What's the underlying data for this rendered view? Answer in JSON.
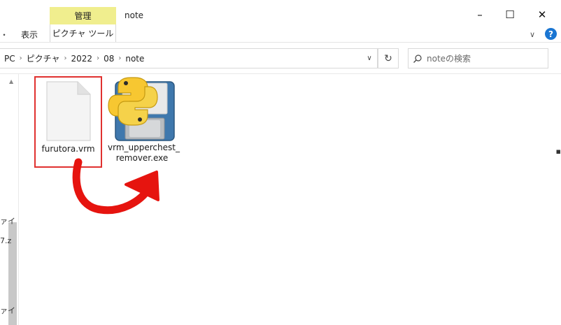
{
  "titlebar": {
    "manage_tab": "管理",
    "picture_tool_tab": "ピクチャ ツール",
    "window_title": "note",
    "view_tab": "表示",
    "left_mark": "・",
    "minimize": "–",
    "maximize": "☐",
    "close": "✕",
    "ribbon_toggle": "∨",
    "help": "?"
  },
  "address": {
    "crumbs": [
      "PC",
      "ピクチャ",
      "2022",
      "08",
      "note"
    ],
    "dropdown": "∨",
    "refresh": "↻"
  },
  "search": {
    "placeholder": "noteの検索"
  },
  "files": [
    {
      "name": "furutora.vrm",
      "selected": true,
      "icon": "blank-document-icon"
    },
    {
      "name_line1": "vrm_upperchest_",
      "name_line2": "remover.exe",
      "selected": false,
      "icon": "python-floppy-icon"
    }
  ],
  "nav_fragments": [
    "ァイ",
    "7.z",
    "ァイ"
  ],
  "annotation": {
    "arrow_color": "#e6140f"
  },
  "colors": {
    "manage_tab_bg": "#f0ee8e",
    "selection_border": "#e0312f",
    "help_blue": "#1b76d2"
  }
}
